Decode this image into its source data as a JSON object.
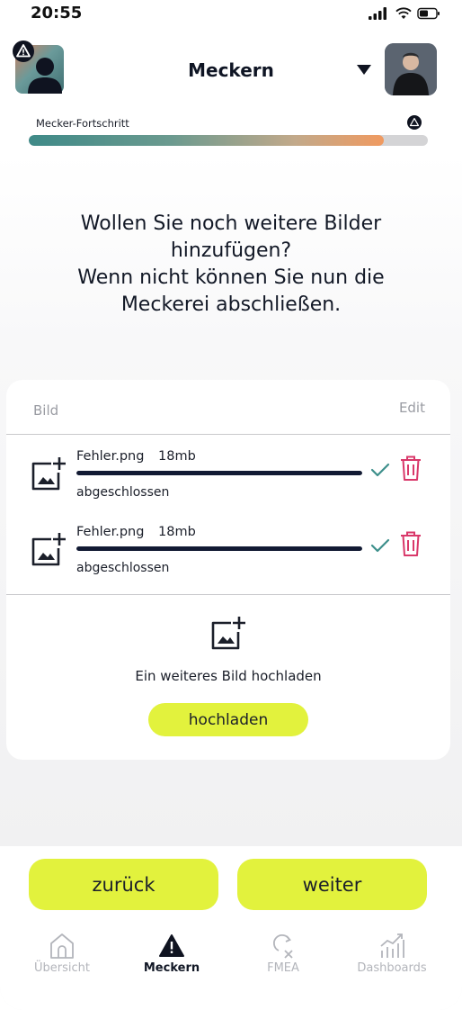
{
  "status_bar": {
    "time": "20:55"
  },
  "header": {
    "title": "Meckern"
  },
  "progress": {
    "label": "Mecker-Fortschritt",
    "value_fraction": 0.89
  },
  "prompt": {
    "lines": [
      "Wollen Sie noch weitere Bilder",
      "hinzufügen?",
      "Wenn nicht können Sie nun die",
      "Meckerei abschließen."
    ]
  },
  "upload_table": {
    "columns": {
      "image": "Bild",
      "edit": "Edit"
    },
    "files": [
      {
        "name": "Fehler.png",
        "size": "18mb",
        "status": "abgeschlossen",
        "progress_fraction": 1.0
      },
      {
        "name": "Fehler.png",
        "size": "18mb",
        "status": "abgeschlossen",
        "progress_fraction": 1.0
      }
    ],
    "add_prompt": "Ein weiteres Bild hochladen",
    "upload_button": "hochladen"
  },
  "navigation": {
    "back": "zurück",
    "next": "weiter"
  },
  "tabs": [
    {
      "label": "Übersicht",
      "icon": "home-icon",
      "active": false
    },
    {
      "label": "Meckern",
      "icon": "warning-icon",
      "active": true
    },
    {
      "label": "FMEA",
      "icon": "fmea-icon",
      "active": false
    },
    {
      "label": "Dashboards",
      "icon": "chart-icon",
      "active": false
    }
  ],
  "colors": {
    "accent": "#e2f23d",
    "dark": "#121a33",
    "success": "#3d8f8b",
    "danger": "#d9386a"
  }
}
